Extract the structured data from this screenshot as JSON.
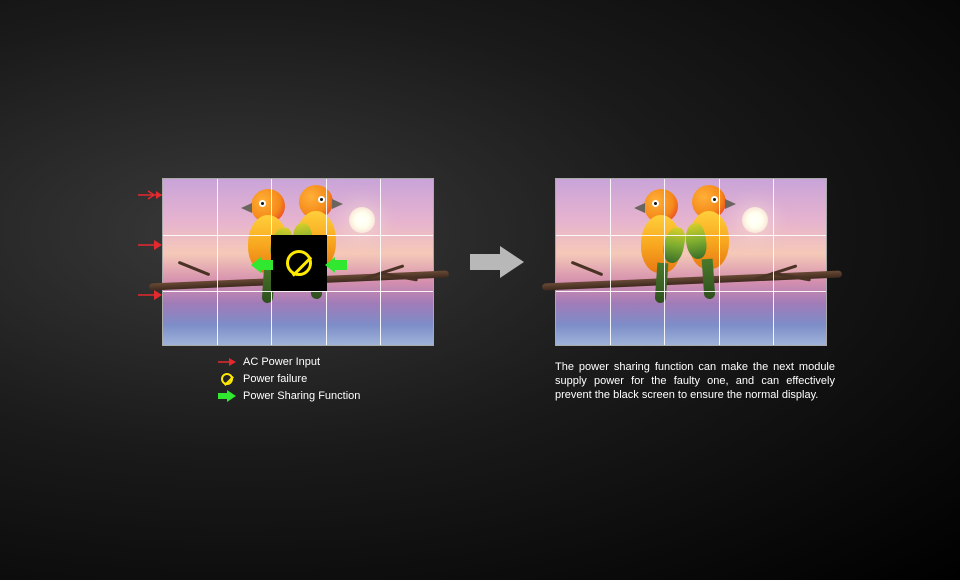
{
  "diagram": {
    "grid": {
      "cols": 5,
      "rows": 3
    },
    "failed_cell": {
      "row": 1,
      "col": 2
    },
    "legend": {
      "ac_input": "AC Power Input",
      "power_failure": "Power failure",
      "power_sharing": "Power Sharing Function"
    },
    "colors": {
      "ac_arrow": "#e4292f",
      "failure_symbol": "#ffea00",
      "sharing_arrow": "#2fe82f",
      "transition_arrow": "#b8b8b8"
    },
    "description": "The power sharing function can make the next module supply power for the faulty one, and can effectively prevent the black screen to ensure the normal display."
  }
}
